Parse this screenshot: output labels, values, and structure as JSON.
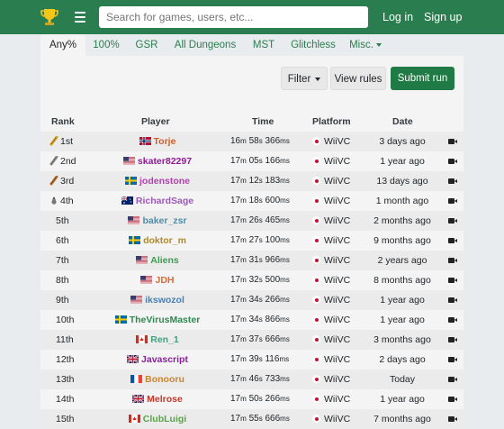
{
  "nav": {
    "search_placeholder": "Search for games, users, etc...",
    "login_label": "Log in",
    "signup_label": "Sign up"
  },
  "tabs": [
    {
      "label": "Any%",
      "active": true
    },
    {
      "label": "100%"
    },
    {
      "label": "GSR"
    },
    {
      "label": "All Dungeons"
    },
    {
      "label": "MST"
    },
    {
      "label": "Glitchless"
    },
    {
      "label": "Misc."
    }
  ],
  "toolbar": {
    "filter_label": "Filter",
    "rules_label": "View rules",
    "submit_label": "Submit run"
  },
  "table": {
    "headers": {
      "rank": "Rank",
      "player": "Player",
      "time": "Time",
      "platform": "Platform",
      "date": "Date"
    },
    "rows": [
      {
        "rank": "1st",
        "medal": "gold",
        "player": "Torje",
        "color": "#d35b29",
        "flag": "NO",
        "t": [
          "16",
          "58",
          "366"
        ],
        "platform": "WiiVC",
        "date": "3 days ago"
      },
      {
        "rank": "2nd",
        "medal": "silver",
        "player": "skater82297",
        "color": "#8e1d96",
        "flag": "US",
        "t": [
          "17",
          "05",
          "166"
        ],
        "platform": "WiiVC",
        "date": "1 year ago"
      },
      {
        "rank": "3rd",
        "medal": "bronze",
        "player": "jodenstone",
        "color": "#b33fb3",
        "flag": "SE",
        "t": [
          "17",
          "12",
          "183"
        ],
        "platform": "WiiVC",
        "date": "13 days ago"
      },
      {
        "rank": "4th",
        "medal": "fourth",
        "player": "RichardSage",
        "color": "#9b59b6",
        "flag": "AU",
        "t": [
          "17",
          "18",
          "600"
        ],
        "platform": "WiiVC",
        "date": "1 month ago"
      },
      {
        "rank": "5th",
        "player": "baker_zsr",
        "color": "#4e8ca8",
        "flag": "US",
        "t": [
          "17",
          "26",
          "465"
        ],
        "platform": "WiiVC",
        "date": "2 months ago"
      },
      {
        "rank": "6th",
        "player": "doktor_m",
        "color": "#b08a2e",
        "flag": "SE",
        "t": [
          "17",
          "27",
          "100"
        ],
        "platform": "WiiVC",
        "date": "9 months ago"
      },
      {
        "rank": "7th",
        "player": "Aliens",
        "color": "#3e9b4f",
        "flag": "US",
        "t": [
          "17",
          "31",
          "966"
        ],
        "platform": "WiiVC",
        "date": "2 years ago"
      },
      {
        "rank": "8th",
        "player": "JDH",
        "color": "#d96a3a",
        "flag": "US",
        "t": [
          "17",
          "32",
          "500"
        ],
        "platform": "WiiVC",
        "date": "8 months ago"
      },
      {
        "rank": "9th",
        "player": "ikswozol",
        "color": "#4a7fb0",
        "flag": "US",
        "t": [
          "17",
          "34",
          "266"
        ],
        "platform": "WiiVC",
        "date": "1 year ago"
      },
      {
        "rank": "10th",
        "player": "TheVirusMaster",
        "color": "#2d8a4e",
        "flag": "SE",
        "t": [
          "17",
          "34",
          "866"
        ],
        "platform": "WiiVC",
        "date": "1 year ago"
      },
      {
        "rank": "11th",
        "player": "Ren_1",
        "color": "#3ea27e",
        "flag": "CA",
        "t": [
          "17",
          "37",
          "666"
        ],
        "platform": "WiiVC",
        "date": "3 months ago"
      },
      {
        "rank": "12th",
        "player": "Javascript",
        "color": "#8b1fa0",
        "flag": "GB",
        "t": [
          "17",
          "39",
          "116"
        ],
        "platform": "WiiVC",
        "date": "2 days ago"
      },
      {
        "rank": "13th",
        "player": "Bonooru",
        "color": "#c8852f",
        "flag": "FR",
        "t": [
          "17",
          "46",
          "733"
        ],
        "platform": "WiiVC",
        "date": "Today"
      },
      {
        "rank": "14th",
        "player": "Melrose",
        "color": "#c0392b",
        "flag": "GB",
        "t": [
          "17",
          "50",
          "266"
        ],
        "platform": "WiiVC",
        "date": "1 year ago"
      },
      {
        "rank": "15th",
        "player": "ClubLuigi",
        "color": "#5aa34a",
        "flag": "CA",
        "t": [
          "17",
          "55",
          "666"
        ],
        "platform": "WiiVC",
        "date": "7 months ago"
      }
    ]
  }
}
